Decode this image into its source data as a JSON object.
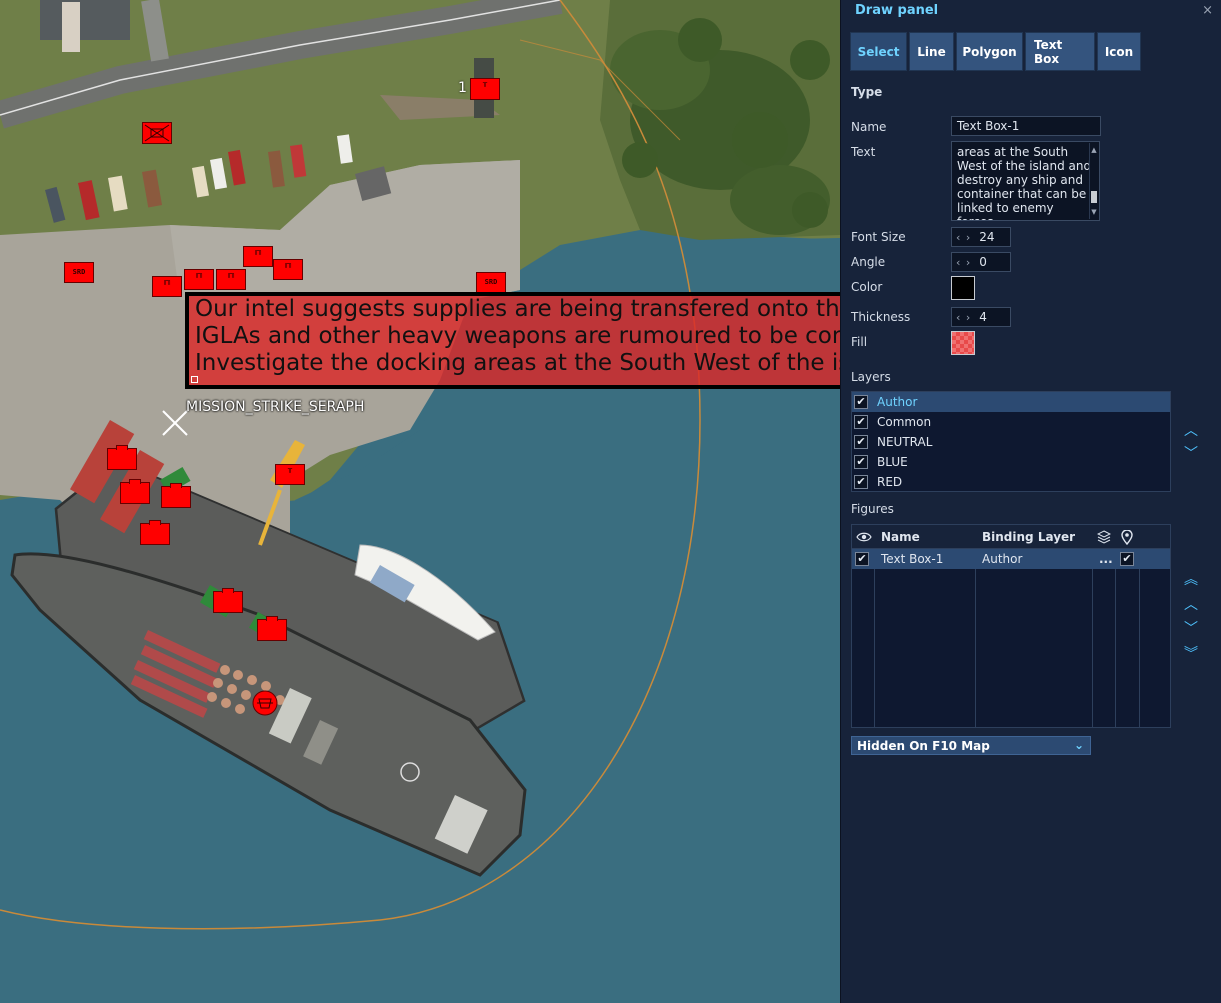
{
  "map": {
    "unit_label": "1",
    "mission_label": "MISSION_STRIKE_SERAPH",
    "unit_short_label": "SRD",
    "text_box_lines": [
      "Our intel suggests supplies are being transfered onto the isl",
      "IGLAs and other heavy weapons are rumoured to be coming",
      "Investigate the docking areas at the South West of the islan"
    ]
  },
  "panel": {
    "title": "Draw panel",
    "close_icon": "×",
    "tabs": [
      "Select",
      "Line",
      "Polygon",
      "Text Box",
      "Icon"
    ],
    "active_tab": "Select",
    "type_heading": "Type",
    "fields": {
      "name_label": "Name",
      "name_value": "Text Box-1",
      "text_label": "Text",
      "text_value_lines": [
        "areas at the South",
        "West of the island and",
        "destroy any ship and",
        "container that can be",
        "linked to enemy forces."
      ],
      "font_size_label": "Font Size",
      "font_size_value": "24",
      "angle_label": "Angle",
      "angle_value": "0",
      "color_label": "Color",
      "color_value": "#000000",
      "thickness_label": "Thickness",
      "thickness_value": "4",
      "fill_label": "Fill",
      "fill_value": "#e84a4a"
    },
    "layers_heading": "Layers",
    "layers": [
      {
        "name": "Author",
        "checked": true,
        "selected": true
      },
      {
        "name": "Common",
        "checked": true,
        "selected": false
      },
      {
        "name": "NEUTRAL",
        "checked": true,
        "selected": false
      },
      {
        "name": "BLUE",
        "checked": true,
        "selected": false
      },
      {
        "name": "RED",
        "checked": true,
        "selected": false
      }
    ],
    "figures_heading": "Figures",
    "figures_columns": {
      "name": "Name",
      "binding": "Binding Layer"
    },
    "figures": [
      {
        "name": "Text Box-1",
        "binding": "Author",
        "more": "...",
        "visible": true,
        "pinned": true
      }
    ],
    "visibility_select": "Hidden On F10 Map"
  },
  "colors": {
    "accent": "#6fd3ff",
    "panel_bg": "#17233a",
    "unit_red": "#ff0000",
    "water": "#3a6e80"
  }
}
